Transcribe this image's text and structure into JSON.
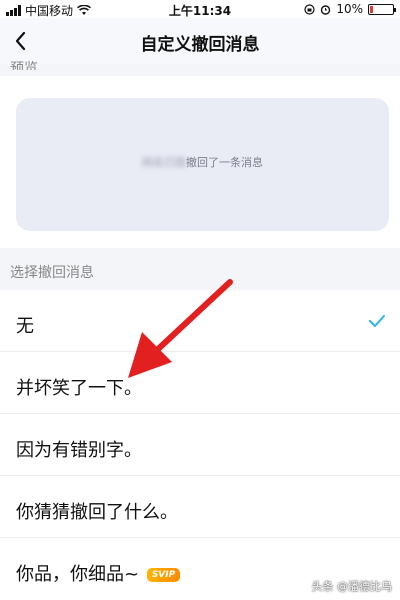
{
  "status_bar": {
    "carrier": "中国移动",
    "time": "上午11:34",
    "battery": "10%"
  },
  "nav": {
    "title": "自定义撤回消息"
  },
  "preview": {
    "label": "预览",
    "blurred_name": "网名已隐",
    "message": "撤回了一条消息"
  },
  "select": {
    "label": "选择撤回消息",
    "options": [
      {
        "label": "无",
        "selected": true
      },
      {
        "label": "并坏笑了一下。",
        "selected": false
      },
      {
        "label": "因为有错别字。",
        "selected": false
      },
      {
        "label": "你猜猜撤回了什么。",
        "selected": false
      },
      {
        "label": "你品，你细品~",
        "badge": "SVIP",
        "selected": false
      }
    ]
  },
  "colors": {
    "check": "#2bb3f0",
    "arrow": "#e32020",
    "badge": "#ff9d00"
  },
  "watermark": "头条 @潘德比乌"
}
